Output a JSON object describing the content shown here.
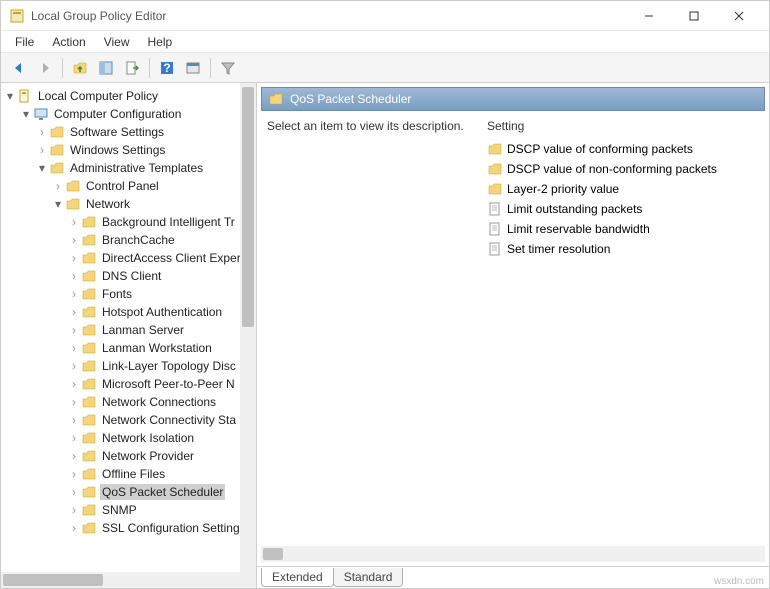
{
  "window": {
    "title": "Local Group Policy Editor"
  },
  "menu": [
    "File",
    "Action",
    "View",
    "Help"
  ],
  "tree": {
    "root": "Local Computer Policy",
    "cc": "Computer Configuration",
    "sw": "Software Settings",
    "win": "Windows Settings",
    "adm": "Administrative Templates",
    "cp": "Control Panel",
    "net": "Network",
    "items": [
      "Background Intelligent Tr",
      "BranchCache",
      "DirectAccess Client Experi",
      "DNS Client",
      "Fonts",
      "Hotspot Authentication",
      "Lanman Server",
      "Lanman Workstation",
      "Link-Layer Topology Disc",
      "Microsoft Peer-to-Peer N",
      "Network Connections",
      "Network Connectivity Sta",
      "Network Isolation",
      "Network Provider",
      "Offline Files",
      "QoS Packet Scheduler",
      "SNMP",
      "SSL Configuration Setting"
    ]
  },
  "detail": {
    "header": "QoS Packet Scheduler",
    "desc": "Select an item to view its description.",
    "setting_label": "Setting",
    "settings": [
      {
        "icon": "folder",
        "label": "DSCP value of conforming packets"
      },
      {
        "icon": "folder",
        "label": "DSCP value of non-conforming packets"
      },
      {
        "icon": "folder",
        "label": "Layer-2 priority value"
      },
      {
        "icon": "page",
        "label": "Limit outstanding packets"
      },
      {
        "icon": "page",
        "label": "Limit reservable bandwidth"
      },
      {
        "icon": "page",
        "label": "Set timer resolution"
      }
    ]
  },
  "tabs": {
    "extended": "Extended",
    "standard": "Standard"
  },
  "watermark": "wsxdn.com"
}
